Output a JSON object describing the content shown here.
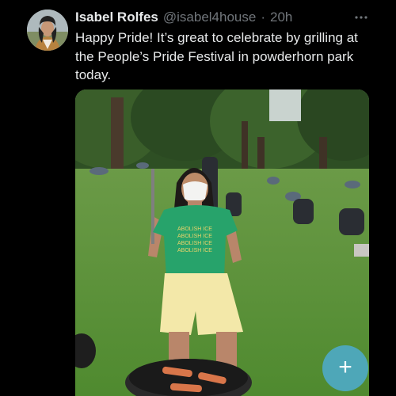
{
  "tweet": {
    "author": {
      "display_name": "Isabel Rolfes",
      "handle": "@isabel4house",
      "separator": "·",
      "timestamp": "20h"
    },
    "text": "Happy Pride! It’s great to celebrate by grilling at the People’s Pride Festival in powderhorn park today.",
    "more_icon": "more-horizontal-icon",
    "photo": {
      "shirt_print": [
        "ABOLISH ICE",
        "ABOLISH ICE",
        "ABOLISH ICE",
        "ABOLISH ICE"
      ]
    }
  },
  "compose": {
    "icon": "plus-icon",
    "label": "+"
  },
  "colors": {
    "background": "#000000",
    "text_primary": "#e7e9ea",
    "text_secondary": "#71767b",
    "fab": "#4dabcb",
    "grass": "#5d8f3a",
    "shirt": "#27a36b"
  }
}
